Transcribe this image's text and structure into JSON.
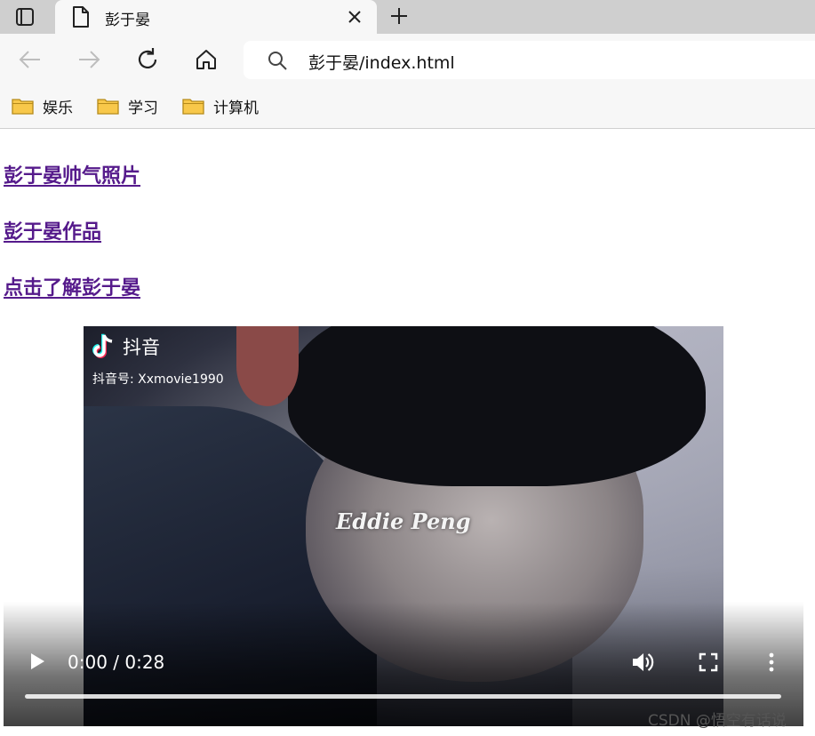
{
  "browser": {
    "tab": {
      "title": "彭于晏"
    },
    "address": {
      "url": "彭于晏/index.html"
    },
    "bookmarks": [
      {
        "label": "娱乐"
      },
      {
        "label": "学习"
      },
      {
        "label": "计算机"
      }
    ]
  },
  "page": {
    "links": [
      {
        "label": "彭于晏帅气照片"
      },
      {
        "label": "彭于晏作品"
      },
      {
        "label": "点击了解彭于晏"
      }
    ],
    "video": {
      "douyin_name": "抖音",
      "douyin_id": "抖音号: Xxmovie1990",
      "signature": "Eddie Peng",
      "time": "0:00 / 0:28",
      "progress": 0
    }
  },
  "watermark": "CSDN @悟空有话说",
  "colors": {
    "link_visited": "#551a8b",
    "chrome_bg": "#f7f7f7",
    "tabbar_bg": "#cfcfcf"
  }
}
